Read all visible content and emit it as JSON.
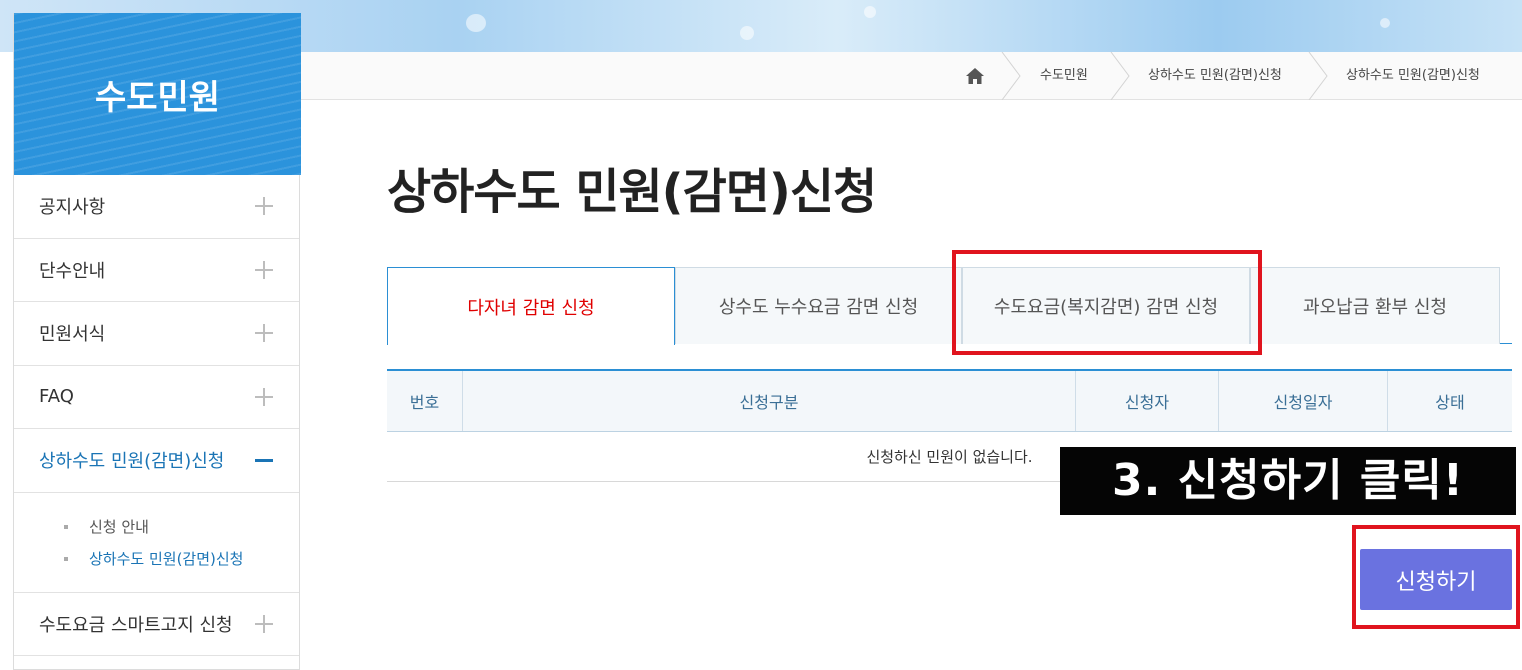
{
  "breadcrumb": [
    "수도민원",
    "상하수도 민원(감면)신청",
    "상하수도 민원(감면)신청"
  ],
  "sidebar": {
    "title": "수도민원",
    "items": [
      {
        "label": "공지사항"
      },
      {
        "label": "단수안내"
      },
      {
        "label": "민원서식"
      },
      {
        "label": "FAQ"
      },
      {
        "label": "상하수도 민원(감면)신청"
      },
      {
        "label": "수도요금 스마트고지 신청"
      }
    ],
    "submenu": [
      "신청 안내",
      "상하수도 민원(감면)신청"
    ]
  },
  "page": {
    "title": "상하수도 민원(감면)신청"
  },
  "tabs": [
    {
      "label": "다자녀 감면 신청"
    },
    {
      "label": "상수도 누수요금 감면 신청"
    },
    {
      "label": "수도요금(복지감면) 감면 신청"
    },
    {
      "label": "과오납금 환부 신청"
    }
  ],
  "table": {
    "columns": [
      "번호",
      "신청구분",
      "신청자",
      "신청일자",
      "상태"
    ],
    "empty_message": "신청하신 민원이 없습니다."
  },
  "caption": "3. 신청하기 클릭!",
  "apply_button": {
    "label": "신청하기"
  },
  "colors": {
    "accent": "#2b8fd4",
    "active_tab_text": "#e00000",
    "button": "#6a72e0",
    "highlight": "#e0141e"
  }
}
